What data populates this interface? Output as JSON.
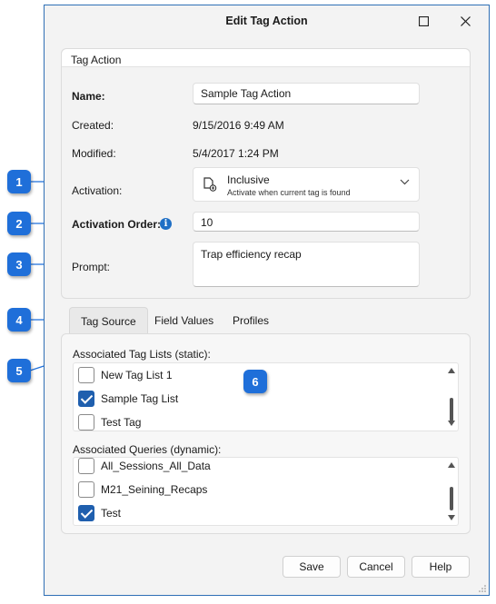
{
  "window": {
    "title": "Edit Tag Action",
    "maximize_glyph": "☐",
    "close_glyph": "✕"
  },
  "group": {
    "header": "Tag Action",
    "name_label": "Name:",
    "name_value": "Sample Tag Action",
    "created_label": "Created:",
    "created_value": "9/15/2016 9:49 AM",
    "modified_label": "Modified:",
    "modified_value": "5/4/2017 1:24 PM",
    "activation_label": "Activation:",
    "activation_main": "Inclusive",
    "activation_sub": "Activate when current tag is found",
    "activation_order_label": "Activation Order:",
    "activation_order_value": "10",
    "prompt_label": "Prompt:",
    "prompt_value": "Trap efficiency recap"
  },
  "tabs": [
    "Tag Source",
    "Field Values",
    "Profiles"
  ],
  "tag_source": {
    "static_label": "Associated Tag Lists (static):",
    "static_items": [
      {
        "label": "New Tag List 1",
        "checked": false
      },
      {
        "label": "Sample Tag List",
        "checked": true
      },
      {
        "label": "Test Tag",
        "checked": false
      }
    ],
    "dynamic_label": "Associated Queries (dynamic):",
    "dynamic_items": [
      {
        "label": "All_Sessions_All_Data",
        "checked": false
      },
      {
        "label": "M21_Seining_Recaps",
        "checked": false
      },
      {
        "label": "Test",
        "checked": true
      }
    ]
  },
  "buttons": {
    "save": "Save",
    "cancel": "Cancel",
    "help": "Help"
  },
  "callouts": [
    "1",
    "2",
    "3",
    "4",
    "5",
    "6"
  ],
  "colors": {
    "accent": "#1f6fd9",
    "checkbox": "#1f5fae",
    "window_border": "#2f6fb5"
  }
}
